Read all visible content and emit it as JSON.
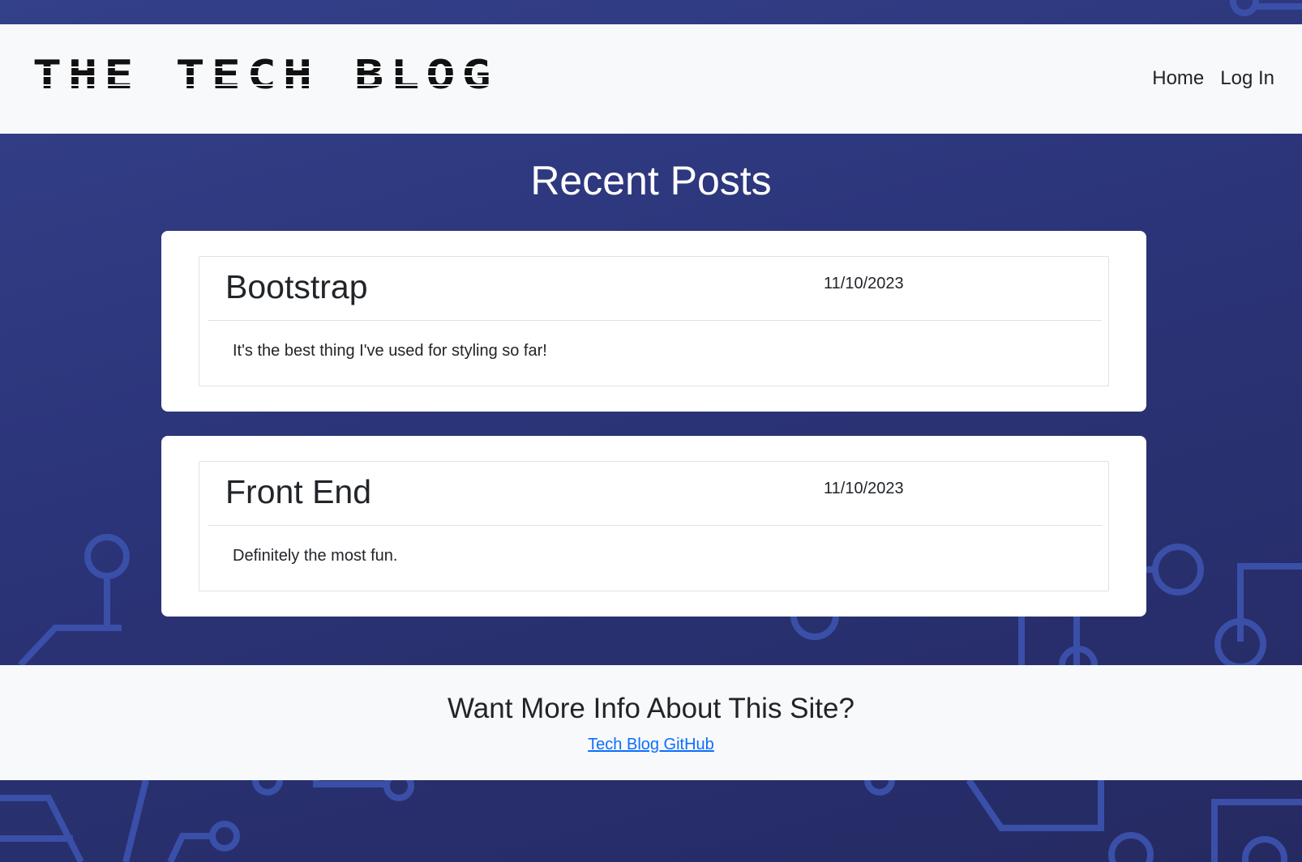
{
  "header": {
    "brand": "The Tech Blog",
    "nav": [
      {
        "label": "Home"
      },
      {
        "label": "Log In"
      }
    ]
  },
  "main": {
    "title": "Recent Posts",
    "posts": [
      {
        "title": "Bootstrap",
        "date": "11/10/2023",
        "body": "It's the best thing I've used for styling so far!"
      },
      {
        "title": "Front End",
        "date": "11/10/2023",
        "body": "Definitely the most fun."
      }
    ]
  },
  "footer": {
    "title": "Want More Info About This Site?",
    "link_label": "Tech Blog GitHub"
  },
  "colors": {
    "background": "#2b3478",
    "circuit": "#3a4fa8",
    "link": "#0d6efd",
    "panel": "#f8f9fa"
  }
}
